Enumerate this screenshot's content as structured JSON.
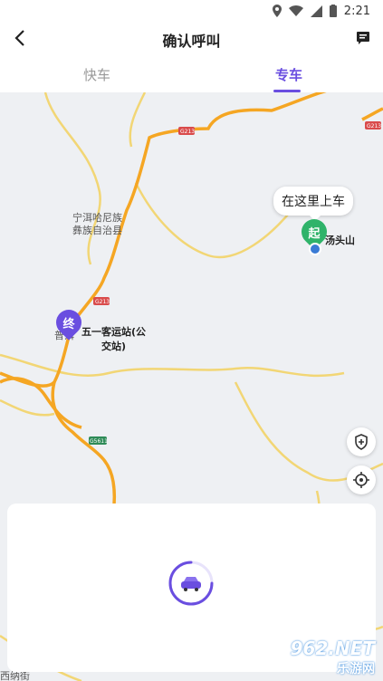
{
  "status_bar": {
    "time": "2:21",
    "icons": [
      "location-icon",
      "wifi-icon",
      "signal-icon",
      "battery-icon"
    ]
  },
  "header": {
    "title": "确认呼叫",
    "back_icon": "back-icon",
    "message_icon": "message-icon"
  },
  "tabs": [
    {
      "label": "快车",
      "active": false
    },
    {
      "label": "专车",
      "active": true
    }
  ],
  "map": {
    "county_label": "宁洱哈尼族\n彝族自治县",
    "destination_label": "五一客运站(公\n交站)",
    "origin_label": "汤头山",
    "pickup_bubble": "在这里上车",
    "start_pin": "起",
    "end_pin": "终",
    "road_badges": [
      "G213",
      "G213",
      "G213",
      "G5611"
    ],
    "cut_label_left_top": "普洱",
    "cut_label_bottom": "西纳街"
  },
  "panel": {
    "loading_icon": "car-loading-icon"
  },
  "watermark": {
    "text_top": "962.NET",
    "text_bottom": "乐游网"
  },
  "colors": {
    "accent": "#6a4ee0",
    "start": "#2fb36a",
    "road_major": "#f5a623",
    "road_minor": "#f2d675"
  }
}
